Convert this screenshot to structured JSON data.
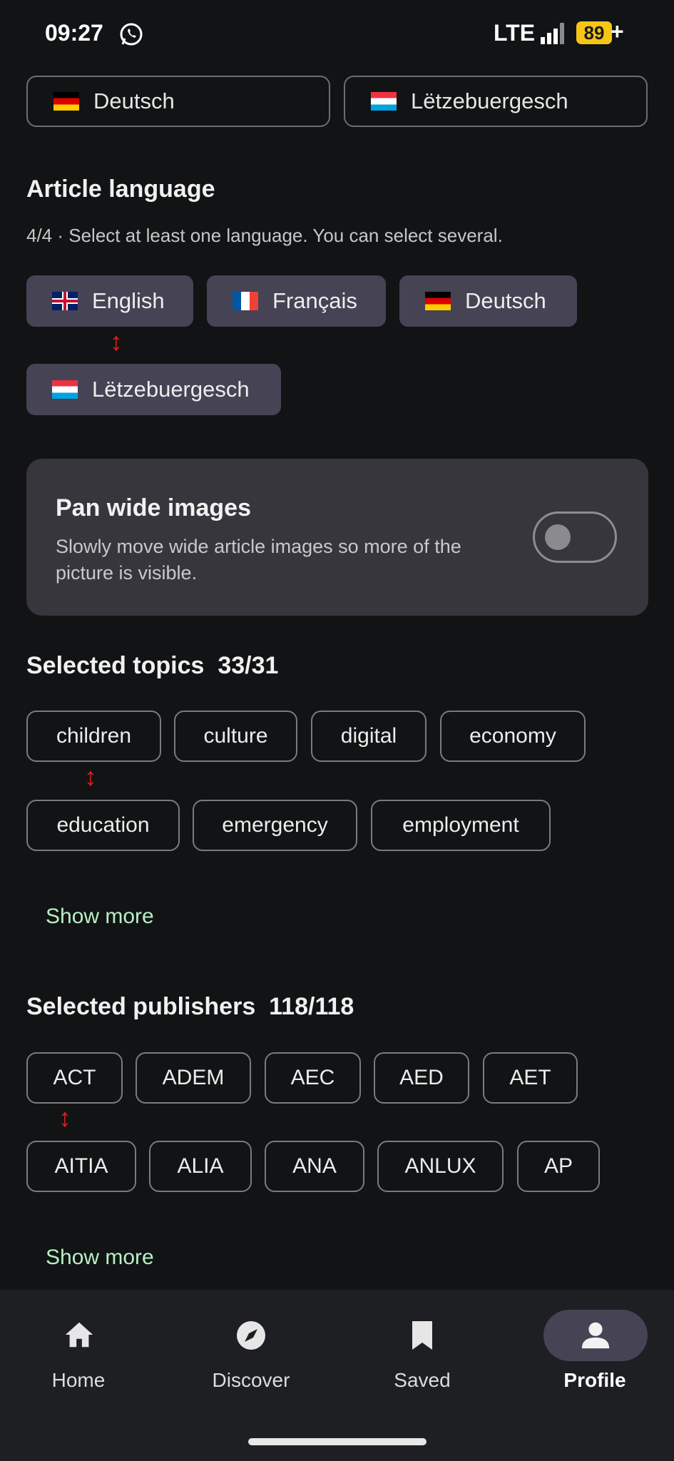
{
  "status_bar": {
    "time": "09:27",
    "app_icon": "whatsapp-icon",
    "network": "LTE",
    "battery": "89",
    "battery_suffix": "+"
  },
  "interface_language_row": [
    {
      "flag": "de",
      "label": "Deutsch"
    },
    {
      "flag": "lu",
      "label": "Lëtzebuergesch"
    }
  ],
  "article_language": {
    "title": "Article language",
    "subtitle": "4/4 · Select at least one language. You can select several.",
    "chips": [
      {
        "flag": "gb",
        "label": "English"
      },
      {
        "flag": "fr",
        "label": "Français"
      },
      {
        "flag": "de",
        "label": "Deutsch"
      },
      {
        "flag": "lu",
        "label": "Lëtzebuergesch"
      }
    ]
  },
  "pan_card": {
    "title": "Pan wide images",
    "description": "Slowly move wide article images so more of the picture is visible.",
    "toggle_on": false
  },
  "topics": {
    "title": "Selected topics",
    "count": "33/31",
    "chips": [
      "children",
      "culture",
      "digital",
      "economy",
      "education",
      "emergency",
      "employment"
    ],
    "show_more": "Show more"
  },
  "publishers": {
    "title": "Selected publishers",
    "count": "118/118",
    "chips": [
      "ACT",
      "ADEM",
      "AEC",
      "AED",
      "AET",
      "AITIA",
      "ALIA",
      "ANA",
      "ANLUX",
      "AP"
    ],
    "show_more": "Show more"
  },
  "annotation_arrow": "↕",
  "nav": {
    "items": [
      {
        "icon": "home-icon",
        "label": "Home"
      },
      {
        "icon": "compass-icon",
        "label": "Discover"
      },
      {
        "icon": "bookmark-icon",
        "label": "Saved"
      },
      {
        "icon": "person-icon",
        "label": "Profile"
      }
    ],
    "active": "Profile"
  },
  "colors": {
    "background": "#111314",
    "chip_filled": "#454354",
    "accent_text": "#b8efc6",
    "annotation": "#e0201b"
  }
}
